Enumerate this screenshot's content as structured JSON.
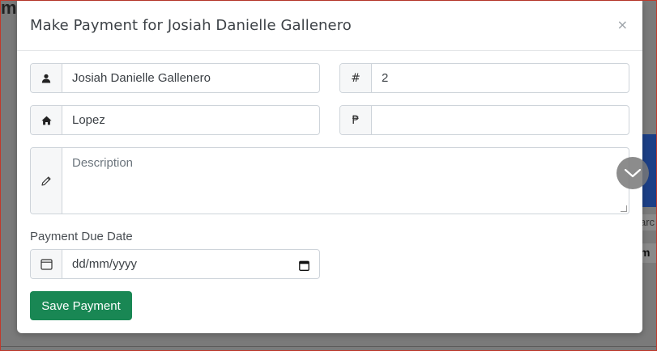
{
  "background": {
    "top_left_fragment": "m",
    "right_fragment_1": "arc",
    "right_fragment_2": "m"
  },
  "modal": {
    "title": "Make Payment for Josiah Danielle Gallenero",
    "close_symbol": "×"
  },
  "form": {
    "name": {
      "icon": "user-icon",
      "value": "Josiah Danielle Gallenero"
    },
    "number": {
      "addon": "#",
      "value": "2"
    },
    "address": {
      "icon": "home-icon",
      "value": "Lopez"
    },
    "amount": {
      "addon": "₱",
      "value": ""
    },
    "description": {
      "icon": "pencil-icon",
      "placeholder": "Description",
      "value": ""
    },
    "due_date": {
      "label": "Payment Due Date",
      "icon": "calendar-icon",
      "placeholder": "dd/mm/yyyy"
    },
    "save_label": "Save Payment"
  },
  "colors": {
    "save_button": "#198754",
    "backdrop": "#7a7a7a",
    "addon_bg": "#f6f7f8"
  }
}
